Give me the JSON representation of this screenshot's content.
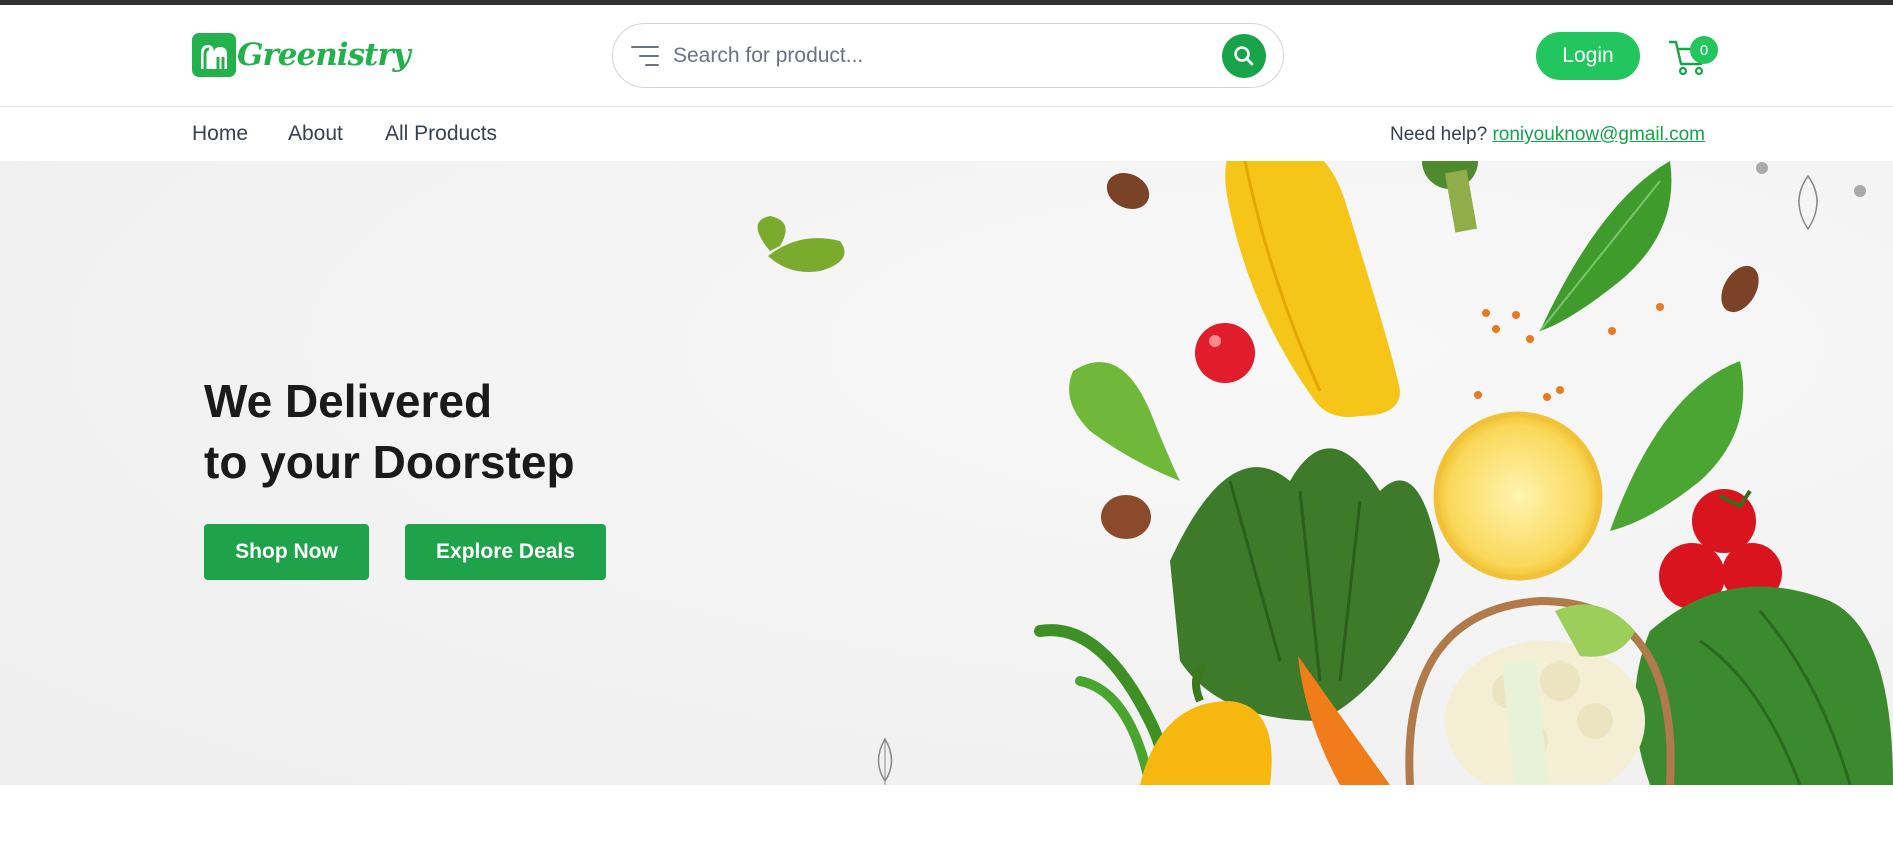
{
  "brand": {
    "name": "Greenistry",
    "colors": {
      "primary": "#22c55e",
      "button": "#1ea34a",
      "topbar": "#333333"
    }
  },
  "search": {
    "placeholder": "Search for product...",
    "menu_icon": "menu-lines-icon",
    "button_icon": "search-icon"
  },
  "header": {
    "login_label": "Login",
    "cart_count": "0",
    "cart_icon": "cart-icon"
  },
  "nav": {
    "links": [
      "Home",
      "About",
      "All Products"
    ],
    "help_label": "Need help?",
    "help_email": "roniyouknow@gmail.com"
  },
  "hero": {
    "title_line1": "We Delivered",
    "title_line2": "to your Doorstep",
    "shop_now_label": "Shop Now",
    "explore_deals_label": "Explore Deals"
  }
}
